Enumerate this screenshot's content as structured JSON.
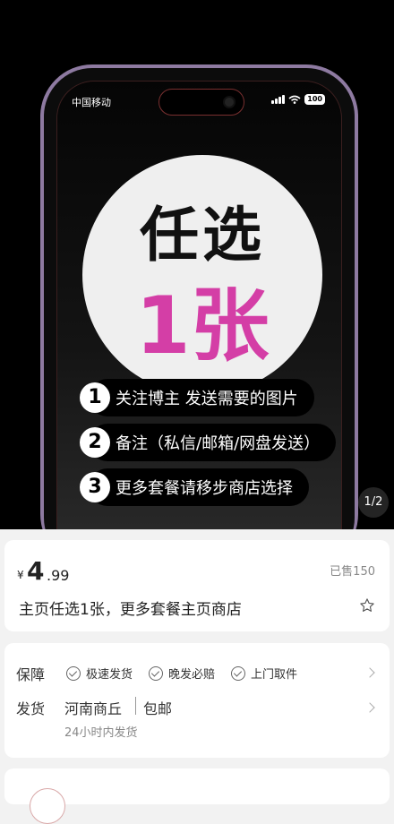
{
  "hero": {
    "status_bar": {
      "carrier": "中国移动",
      "battery": "100"
    },
    "poster": {
      "headline_line1": "任选",
      "headline_line2": "1张",
      "steps": [
        {
          "num": "1",
          "text": "关注博主 发送需要的图片"
        },
        {
          "num": "2",
          "text": "备注（私信/邮箱/网盘发送）"
        },
        {
          "num": "3",
          "text": "更多套餐请移步商店选择"
        }
      ]
    },
    "pager": "1/2"
  },
  "product": {
    "currency": "¥",
    "price_int": "4",
    "price_dec": ".99",
    "sold": "已售150",
    "title": "主页任选1张，更多套餐主页商店"
  },
  "service": {
    "guarantee_label": "保障",
    "guarantees": [
      "极速发货",
      "晚发必赔",
      "上门取件"
    ],
    "shipping_label": "发货",
    "ship_from": "河南商丘",
    "ship_free": "包邮",
    "ship_time": "24小时内发货"
  },
  "colors": {
    "accent": "#d43ea6",
    "phone_frame": "#8e7aa1"
  }
}
